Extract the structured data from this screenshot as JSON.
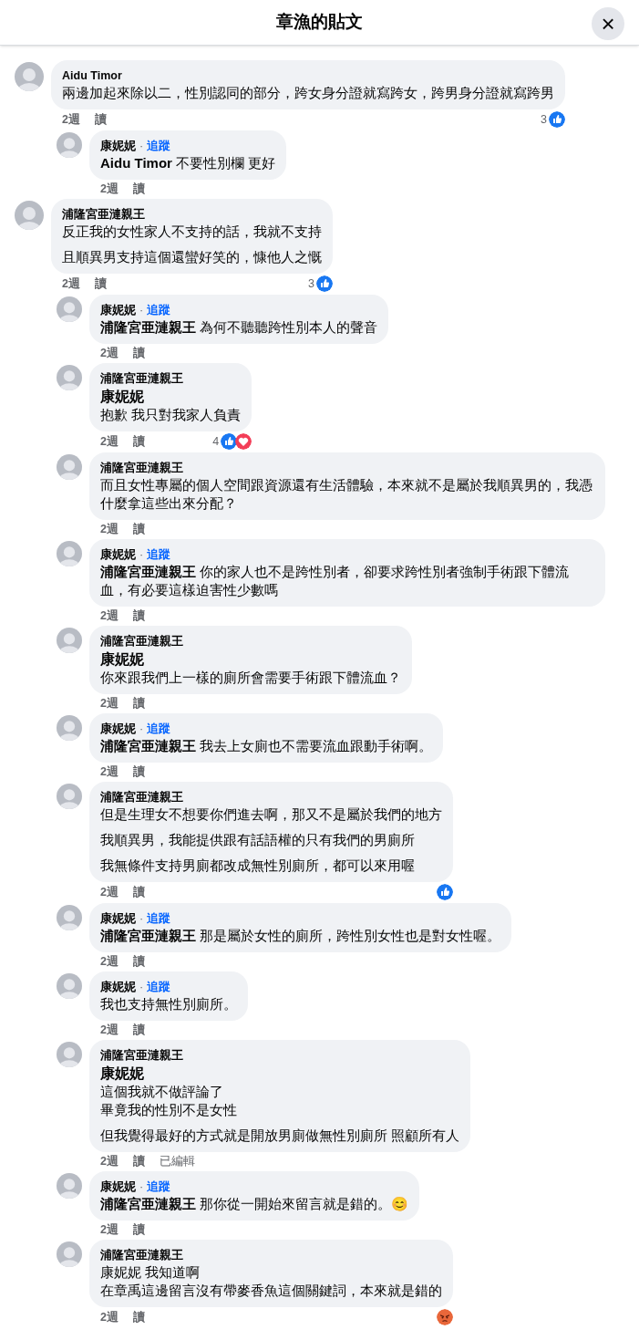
{
  "header": {
    "title": "章漁的貼文",
    "close": "×"
  },
  "comments": [
    {
      "author": "Aidu Timor",
      "paragraphs": [
        [
          "兩邊加起來除以二，性別認同的部分，跨女身分證就寫跨女，跨男身分證就寫跨男"
        ]
      ],
      "time": "2週",
      "action": "讀",
      "reactions": {
        "count": "3",
        "items": [
          {
            "kind": "like"
          }
        ]
      },
      "children": [
        {
          "author": "康妮妮",
          "separator": "·",
          "follow": "追蹤",
          "paragraphs": [
            [
              "**Aidu Timor** 不要性別欄 更好"
            ]
          ],
          "time": "2週",
          "action": "讀"
        }
      ]
    },
    {
      "author": "浦隆宮亜漣親王",
      "paragraphs": [
        [
          "反正我的女性家人不支持的話，我就不支持"
        ],
        [
          "且順異男支持這個還蠻好笑的，慷他人之慨"
        ]
      ],
      "time": "2週",
      "action": "讀",
      "reactions": {
        "count": "3",
        "items": [
          {
            "kind": "like"
          }
        ]
      },
      "children": [
        {
          "author": "康妮妮",
          "separator": "·",
          "follow": "追蹤",
          "paragraphs": [
            [
              "**浦隆宮亜漣親王** 為何不聽聽跨性別本人的聲音"
            ]
          ],
          "time": "2週",
          "action": "讀"
        },
        {
          "author": "浦隆宮亜漣親王",
          "mention": "康妮妮",
          "paragraphs": [
            [
              "抱歉 我只對我家人負責"
            ]
          ],
          "time": "2週",
          "action": "讀",
          "reactions": {
            "count": "4",
            "items": [
              {
                "kind": "like"
              },
              {
                "kind": "love"
              }
            ]
          }
        },
        {
          "author": "浦隆宮亜漣親王",
          "paragraphs": [
            [
              "而且女性專屬的個人空間跟資源還有生活體驗，本來就不是屬於我順異男的，我憑什麼拿這些出來分配？"
            ]
          ],
          "time": "2週",
          "action": "讀"
        },
        {
          "author": "康妮妮",
          "separator": "·",
          "follow": "追蹤",
          "paragraphs": [
            [
              "**浦隆宮亜漣親王** 你的家人也不是跨性別者，卻要求跨性別者強制手術跟下體流血，有必要這樣迫害性少數嗎"
            ]
          ],
          "time": "2週",
          "action": "讀"
        },
        {
          "author": "浦隆宮亜漣親王",
          "mention": "康妮妮",
          "paragraphs": [
            [
              "你來跟我們上一樣的廁所會需要手術跟下體流血？"
            ]
          ],
          "time": "2週",
          "action": "讀"
        },
        {
          "author": "康妮妮",
          "separator": "·",
          "follow": "追蹤",
          "paragraphs": [
            [
              "**浦隆宮亜漣親王** 我去上女廁也不需要流血跟動手術啊。"
            ]
          ],
          "time": "2週",
          "action": "讀"
        },
        {
          "author": "浦隆宮亜漣親王",
          "paragraphs": [
            [
              "但是生理女不想要你們進去啊，那又不是屬於我們的地方"
            ],
            [
              "我順異男，我能提供跟有話語權的只有我們的男廁所"
            ],
            [
              "我無條件支持男廁都改成無性別廁所，都可以來用喔"
            ]
          ],
          "time": "2週",
          "action": "讀",
          "reactions": {
            "items": [
              {
                "kind": "like"
              }
            ]
          }
        },
        {
          "author": "康妮妮",
          "separator": "·",
          "follow": "追蹤",
          "paragraphs": [
            [
              "**浦隆宮亜漣親王** 那是屬於女性的廁所，跨性別女性也是對女性喔。"
            ]
          ],
          "time": "2週",
          "action": "讀"
        },
        {
          "author": "康妮妮",
          "separator": "·",
          "follow": "追蹤",
          "paragraphs": [
            [
              "我也支持無性別廁所。"
            ]
          ],
          "time": "2週",
          "action": "讀"
        },
        {
          "author": "浦隆宮亜漣親王",
          "mention": "康妮妮",
          "paragraphs": [
            [
              "這個我就不做評論了",
              "畢竟我的性別不是女性"
            ],
            [
              "但我覺得最好的方式就是開放男廁做無性別廁所 照顧所有人"
            ]
          ],
          "time": "2週",
          "action": "讀",
          "edited": "已編輯"
        },
        {
          "author": "康妮妮",
          "separator": "·",
          "follow": "追蹤",
          "paragraphs": [
            [
              "**浦隆宮亜漣親王** 那你從一開始來留言就是錯的。😊"
            ]
          ],
          "time": "2週",
          "action": "讀"
        },
        {
          "author": "浦隆宮亜漣親王",
          "paragraphs": [
            [
              "康妮妮 我知道啊",
              "在章禹這邊留言沒有帶麥香魚這個關鍵詞，本來就是錯的"
            ]
          ],
          "time": "2週",
          "action": "讀",
          "reactions": {
            "items": [
              {
                "kind": "angry"
              }
            ]
          }
        }
      ]
    }
  ]
}
